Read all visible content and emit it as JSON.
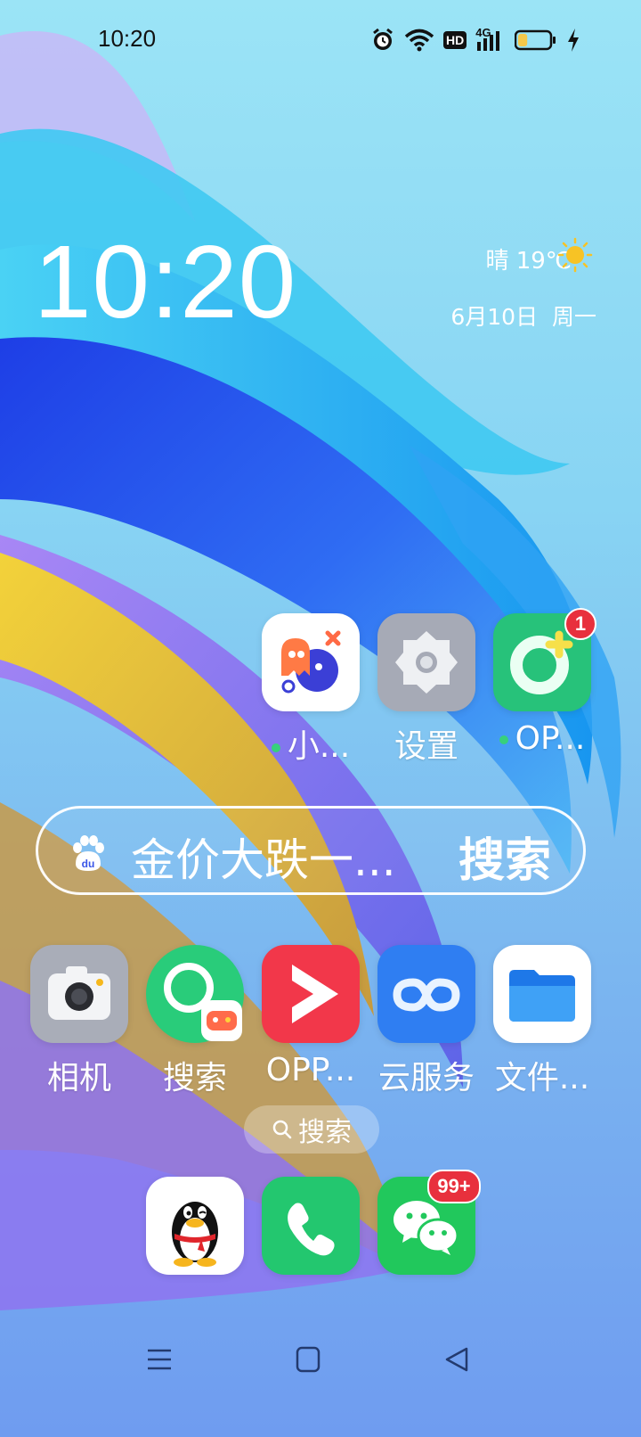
{
  "status_bar": {
    "time": "10:20",
    "hd_label": "HD",
    "net_label": "4G",
    "battery_level": 0.3,
    "battery_color": "#f5c84a"
  },
  "clock_widget": {
    "time": "10:20",
    "weather": "晴 19℃",
    "date": "6月10日  周一"
  },
  "row1": [
    {
      "label": "小...",
      "dot": true,
      "icon": "ghost-game-icon"
    },
    {
      "label": "设置",
      "dot": false,
      "icon": "gear-icon"
    },
    {
      "label": "OP...",
      "dot": true,
      "icon": "oppo-health-icon",
      "badge": "1"
    }
  ],
  "search_widget": {
    "query": "金价大跌一...",
    "button": "搜索",
    "icon": "baidu-paw-icon"
  },
  "row2": [
    {
      "label": "相机",
      "icon": "camera-icon"
    },
    {
      "label": "搜索",
      "icon": "search-games-icon"
    },
    {
      "label": "OPP...",
      "icon": "video-play-icon"
    },
    {
      "label": "云服务",
      "icon": "cloud-infinity-icon"
    },
    {
      "label": "文件...",
      "icon": "folder-icon"
    }
  ],
  "page_search": {
    "label": "搜索"
  },
  "dock": [
    {
      "icon": "qq-penguin-icon"
    },
    {
      "icon": "phone-icon"
    },
    {
      "icon": "wechat-icon",
      "badge": "99+"
    }
  ],
  "nav_bar": {
    "icons": [
      "menu-icon",
      "home-icon",
      "back-icon"
    ]
  }
}
